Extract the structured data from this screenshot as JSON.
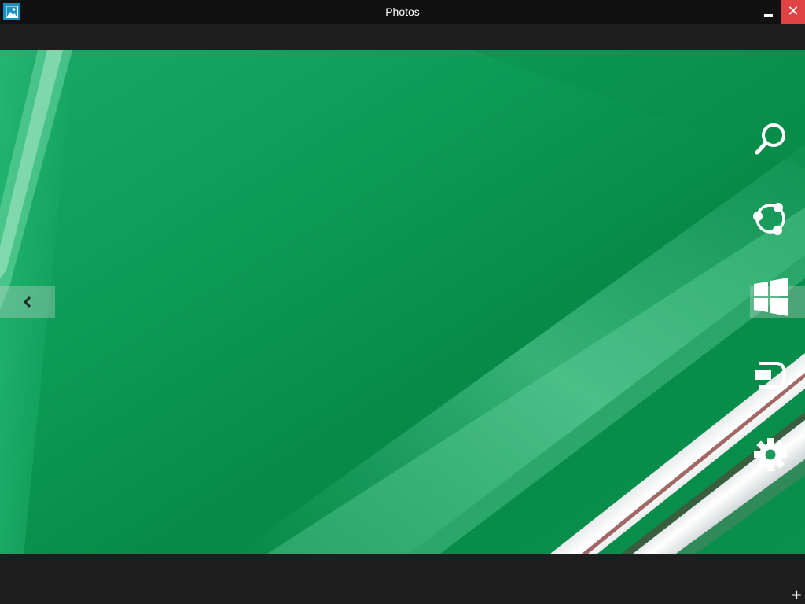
{
  "window": {
    "title": "Photos",
    "close_glyph": "✕",
    "minimize_label": "minimize"
  },
  "colors": {
    "titlebar_bg": "#111111",
    "frame_bg": "#1e1e1e",
    "close_bg": "#e04343",
    "photo_green": "#0a9a52",
    "icon_white": "#ffffff"
  },
  "icons": {
    "app": "photos-app-icon",
    "prev": "chevron-left-icon",
    "charms": [
      "search-icon",
      "share-icon",
      "windows-start-icon",
      "devices-icon",
      "settings-gear-icon"
    ]
  },
  "footer": {
    "plus_glyph": "+"
  }
}
